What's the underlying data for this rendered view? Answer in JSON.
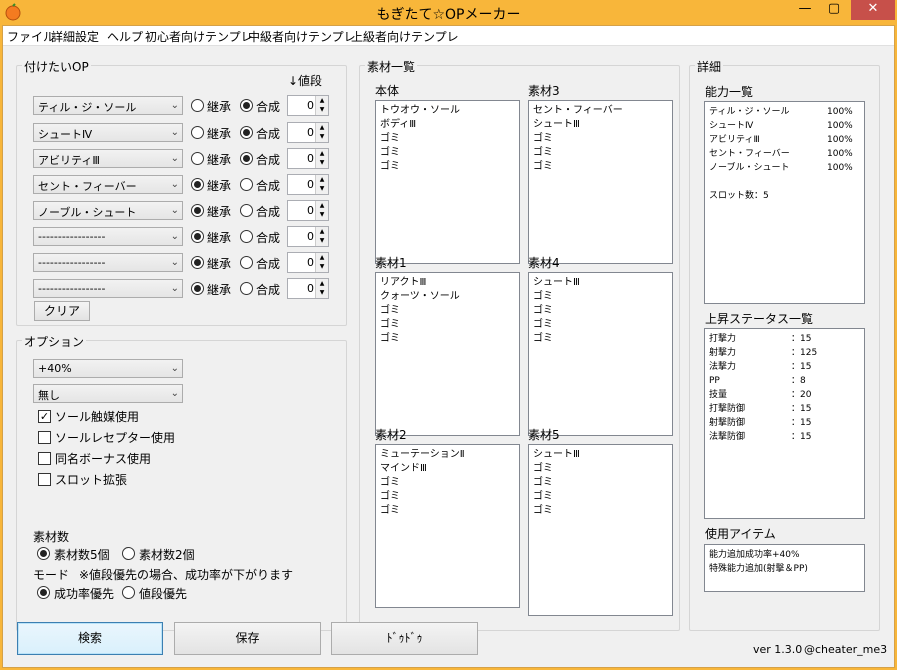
{
  "window": {
    "title": "もぎたて☆OPメーカー",
    "min": "—",
    "max": "▢",
    "close": "✕"
  },
  "menu": [
    "ファイル",
    "詳細設定",
    "ヘルプ",
    "初心者向けテンプレ",
    "中級者向けテンプレ",
    "上級者向けテンプレ"
  ],
  "op": {
    "group_label": "付けたいOP",
    "value_header": "↓値段",
    "rows": [
      {
        "combo": "ティル・ジ・ソール",
        "inherit": "継承",
        "synth": "合成",
        "selected": "synth",
        "value": "0"
      },
      {
        "combo": "シュートⅣ",
        "inherit": "継承",
        "synth": "合成",
        "selected": "synth",
        "value": "0"
      },
      {
        "combo": "アビリティⅢ",
        "inherit": "継承",
        "synth": "合成",
        "selected": "synth",
        "value": "0"
      },
      {
        "combo": "セント・フィーバー",
        "inherit": "継承",
        "synth": "合成",
        "selected": "inherit",
        "value": "0"
      },
      {
        "combo": "ノーブル・シュート",
        "inherit": "継承",
        "synth": "合成",
        "selected": "inherit",
        "value": "0"
      },
      {
        "combo": "-----------------",
        "inherit": "継承",
        "synth": "合成",
        "selected": "inherit",
        "value": "0"
      },
      {
        "combo": "-----------------",
        "inherit": "継承",
        "synth": "合成",
        "selected": "inherit",
        "value": "0"
      },
      {
        "combo": "-----------------",
        "inherit": "継承",
        "synth": "合成",
        "selected": "inherit",
        "value": "0"
      }
    ],
    "clear": "クリア"
  },
  "options": {
    "group_label": "オプション",
    "combo1": "+40%",
    "combo2": "無し",
    "checks": [
      {
        "label": "ソール触媒使用",
        "checked": true
      },
      {
        "label": "ソールレセプター使用",
        "checked": false
      },
      {
        "label": "同名ボーナス使用",
        "checked": false
      },
      {
        "label": "スロット拡張",
        "checked": false
      }
    ],
    "material_count_label": "素材数",
    "mc_opt1": "素材数5個",
    "mc_opt2": "素材数2個",
    "mc_selected": 1,
    "mode_label": "モード",
    "mode_note": "※値段優先の場合、成功率が下がります",
    "mode_opt1": "成功率優先",
    "mode_opt2": "値段優先",
    "mode_selected": 1
  },
  "materials": {
    "group_label": "素材一覧",
    "boxes": [
      {
        "label": "本体",
        "items": [
          "トウオウ・ソール",
          "ボディⅢ",
          "ゴミ",
          "ゴミ",
          "ゴミ"
        ]
      },
      {
        "label": "素材3",
        "items": [
          "セント・フィーバー",
          "シュートⅢ",
          "ゴミ",
          "ゴミ",
          "ゴミ"
        ]
      },
      {
        "label": "素材1",
        "items": [
          "リアクトⅢ",
          "クォーツ・ソール",
          "ゴミ",
          "ゴミ",
          "ゴミ"
        ]
      },
      {
        "label": "素材4",
        "items": [
          "シュートⅢ",
          "ゴミ",
          "ゴミ",
          "ゴミ",
          "ゴミ"
        ]
      },
      {
        "label": "素材2",
        "items": [
          "ミューテーションⅡ",
          "マインドⅢ",
          "ゴミ",
          "ゴミ",
          "ゴミ"
        ]
      },
      {
        "label": "素材5",
        "items": [
          "シュートⅢ",
          "ゴミ",
          "ゴミ",
          "ゴミ",
          "ゴミ"
        ]
      }
    ]
  },
  "details": {
    "group_label": "詳細",
    "ability_label": "能力一覧",
    "abilities": [
      {
        "name": "ティル・ジ・ソール",
        "rate": "100%"
      },
      {
        "name": "シュートⅣ",
        "rate": "100%"
      },
      {
        "name": "アビリティⅢ",
        "rate": "100%"
      },
      {
        "name": "セント・フィーバー",
        "rate": "100%"
      },
      {
        "name": "ノーブル・シュート",
        "rate": "100%"
      }
    ],
    "slots": "スロット数：5",
    "stats_label": "上昇ステータス一覧",
    "stats": [
      {
        "name": "打撃力",
        "value": "：15"
      },
      {
        "name": "射撃力",
        "value": "：125"
      },
      {
        "name": "法撃力",
        "value": "：15"
      },
      {
        "name": "PP",
        "value": "：8"
      },
      {
        "name": "技量",
        "value": "：20"
      },
      {
        "name": "打撃防御",
        "value": "：15"
      },
      {
        "name": "射撃防御",
        "value": "：15"
      },
      {
        "name": "法撃防御",
        "value": "：15"
      }
    ],
    "items_label": "使用アイテム",
    "items": [
      "能力追加成功率+40%",
      "特殊能力追加(射撃＆PP)"
    ]
  },
  "buttons": {
    "search": "検索",
    "save": "保存",
    "dudu": "ﾄﾞｩﾄﾞｩ"
  },
  "footer": {
    "version": "ver 1.3.0",
    "author": "@cheater_me3"
  }
}
